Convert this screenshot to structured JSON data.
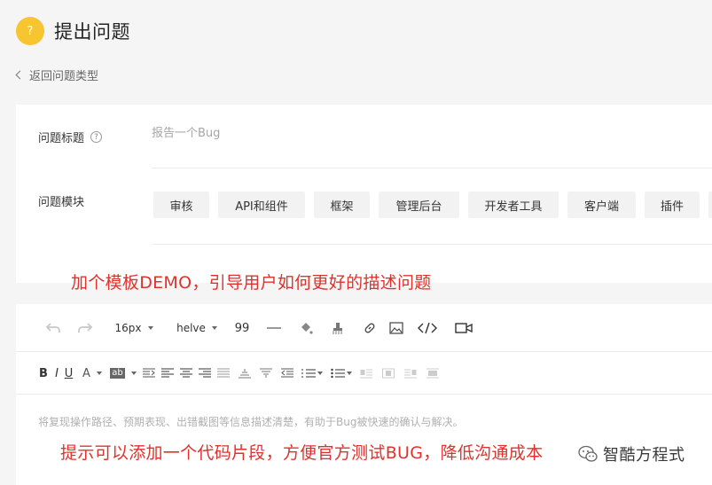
{
  "header": {
    "icon_glyph": "?",
    "title": "提出问题",
    "accent": "#f7c52f"
  },
  "back_link": {
    "label": "返回问题类型"
  },
  "form": {
    "title_label": "问题标题",
    "title_placeholder": "报告一个Bug",
    "title_value": "",
    "module_label": "问题模块",
    "modules": [
      "审核",
      "API和组件",
      "框架",
      "管理后台",
      "开发者工具",
      "客户端",
      "插件",
      ""
    ]
  },
  "annotations": {
    "demo": "加个模板DEMO，引导用户如何更好的描述问题",
    "code": "提示可以添加一个代码片段，方便官方测试BUG，降低沟通成本",
    "color": "#e0322d"
  },
  "toolbar": {
    "font_size": "16px",
    "font_family": "helve",
    "quote": "99",
    "row1_icons": [
      "undo-icon",
      "redo-icon",
      "font-size-select",
      "font-family-select",
      "quote-icon",
      "hr-icon",
      "paint-bucket-icon",
      "eraser-icon",
      "link-icon",
      "image-icon",
      "code-icon",
      "video-icon"
    ],
    "row2": {
      "bold": "B",
      "italic": "I",
      "underline": "U",
      "font_color": "A",
      "highlight": "ab",
      "icons": [
        "text-indent-icon",
        "align-left-icon",
        "align-center-icon",
        "align-right-icon",
        "align-justify-icon",
        "vertical-top-icon",
        "vertical-bottom-icon",
        "outdent-icon",
        "ordered-list-icon",
        "unordered-list-icon",
        "table-icon-1",
        "table-icon-2",
        "table-icon-3",
        "table-icon-4"
      ]
    }
  },
  "editor": {
    "placeholder": "将复现操作路径、预期表现、出错截图等信息描述清楚，有助于Bug被快速的确认与解决。"
  },
  "watermark": {
    "text": "智酷方程式"
  }
}
